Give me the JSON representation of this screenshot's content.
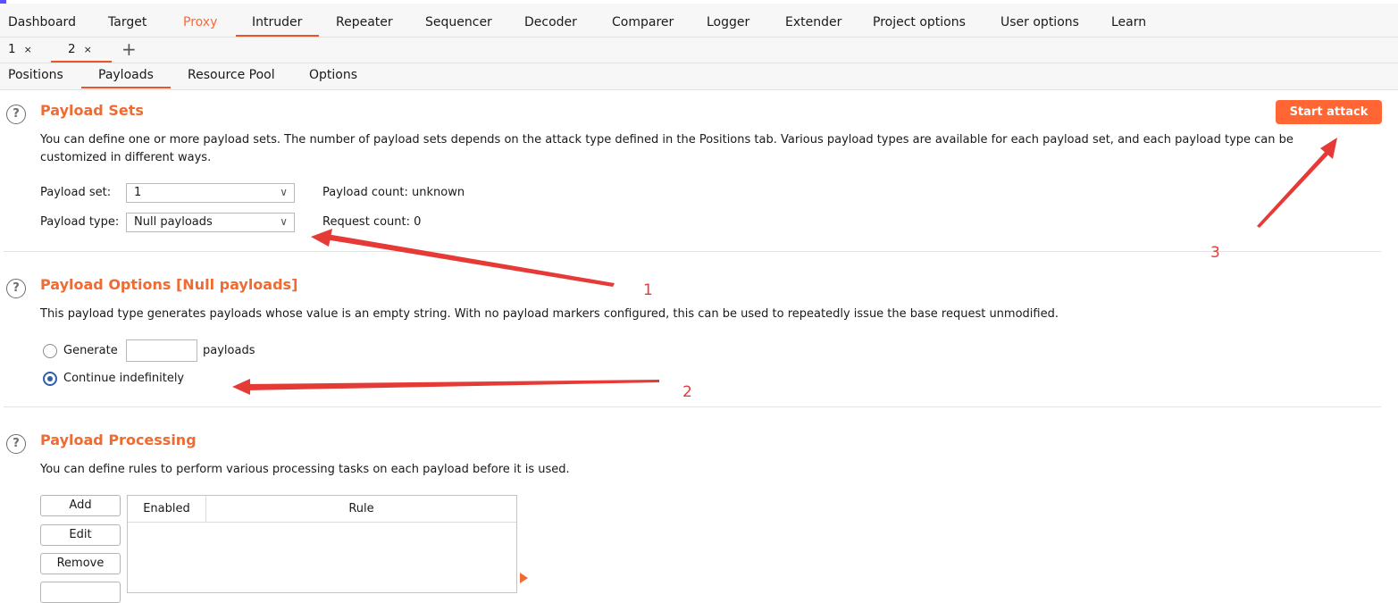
{
  "menubar": {
    "items": [
      "Dashboard",
      "Target",
      "Proxy",
      "Intruder",
      "Repeater",
      "Sequencer",
      "Decoder",
      "Comparer",
      "Logger",
      "Extender",
      "Project options",
      "User options",
      "Learn"
    ],
    "active": "Intruder",
    "highlight": "Proxy"
  },
  "request_tabs": {
    "tabs": [
      {
        "label": "1",
        "close": "×"
      },
      {
        "label": "2",
        "close": "×"
      }
    ],
    "add": "+",
    "active": "2"
  },
  "subtabs": {
    "items": [
      "Positions",
      "Payloads",
      "Resource Pool",
      "Options"
    ],
    "active": "Payloads"
  },
  "payload_sets": {
    "title": "Payload Sets",
    "description": "You can define one or more payload sets. The number of payload sets depends on the attack type defined in the Positions tab. Various payload types are available for each payload set, and each payload type can be customized in different ways.",
    "set_label": "Payload set:",
    "set_value": "1",
    "type_label": "Payload type:",
    "type_value": "Null payloads",
    "payload_count": "Payload count: unknown",
    "request_count": "Request count: 0",
    "start_attack": "Start attack"
  },
  "payload_options": {
    "title": "Payload Options [Null payloads]",
    "description": "This payload type generates payloads whose value is an empty string. With no payload markers configured, this can be used to repeatedly issue the base request unmodified.",
    "generate_label": "Generate",
    "generate_value": "",
    "payloads_suffix": "payloads",
    "continue_label": "Continue indefinitely",
    "selected": "continue"
  },
  "payload_processing": {
    "title": "Payload Processing",
    "description": "You can define rules to perform various processing tasks on each payload before it is used.",
    "buttons": [
      "Add",
      "Edit",
      "Remove"
    ],
    "columns": [
      "Enabled",
      "Rule"
    ],
    "rows": []
  },
  "annotations": [
    "1",
    "2",
    "3"
  ],
  "colors": {
    "accent": "#ff6633",
    "annotation": "#e53a36"
  }
}
